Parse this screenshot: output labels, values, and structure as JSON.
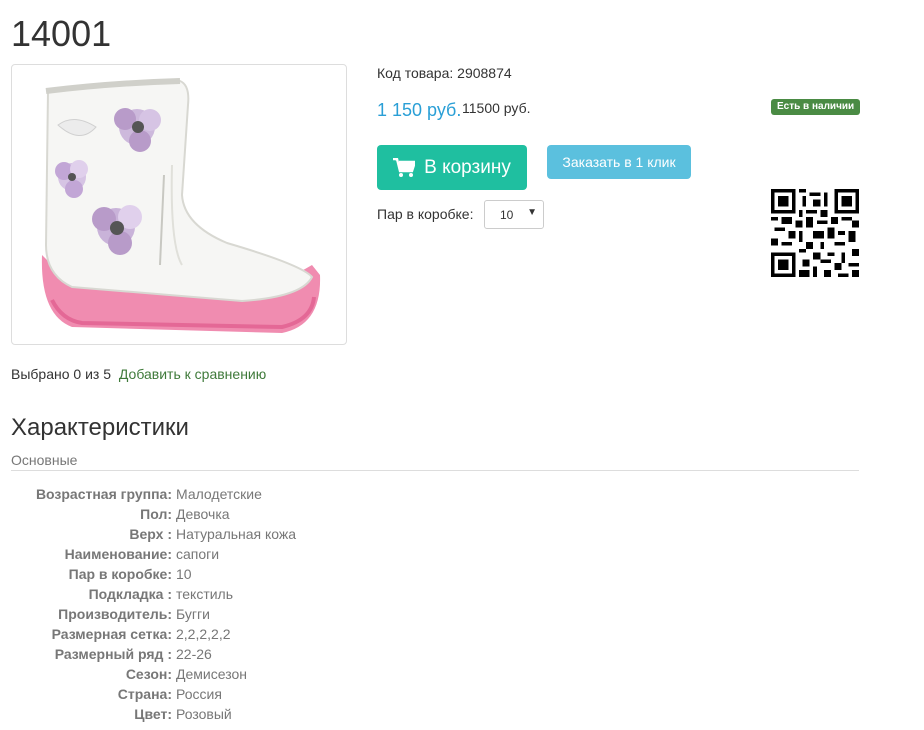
{
  "product": {
    "title": "14001",
    "code": "Код товара: 2908874",
    "price": "1 150 руб.",
    "old_price": "11500 руб.",
    "availability": "Есть в наличии",
    "cart_button": "В корзину",
    "one_click_button": "Заказать в 1 клик",
    "pairs_label": "Пар в коробке:",
    "pairs_value": "10"
  },
  "compare": {
    "selected": "Выбрано 0 из 5",
    "add_link": "Добавить к сравнению"
  },
  "characteristics": {
    "title": "Характеристики",
    "group": "Основные",
    "rows": [
      {
        "label": "Возрастная группа:",
        "value": "Малодетские"
      },
      {
        "label": "Пол:",
        "value": "Девочка"
      },
      {
        "label": "Верх :",
        "value": "Натуральная кожа"
      },
      {
        "label": "Наименование:",
        "value": "сапоги"
      },
      {
        "label": "Пар в коробке:",
        "value": "10"
      },
      {
        "label": "Подкладка :",
        "value": "текстиль"
      },
      {
        "label": "Производитель:",
        "value": "Бугги"
      },
      {
        "label": "Размерная сетка:",
        "value": "2,2,2,2,2"
      },
      {
        "label": "Размерный ряд :",
        "value": "22-26"
      },
      {
        "label": "Сезон:",
        "value": "Демисезон"
      },
      {
        "label": "Страна:",
        "value": "Россия"
      },
      {
        "label": "Цвет:",
        "value": "Розовый"
      }
    ]
  },
  "colors": {
    "price": "#2a9fd6",
    "cart_button": "#1fbfa0",
    "one_click_button": "#5bc0de",
    "badge": "#4a8b44",
    "compare_link": "#3f7a3a"
  },
  "icons": {
    "cart": "cart-icon",
    "qr": "qr-code-icon",
    "select_arrow": "chevron-down-icon"
  }
}
